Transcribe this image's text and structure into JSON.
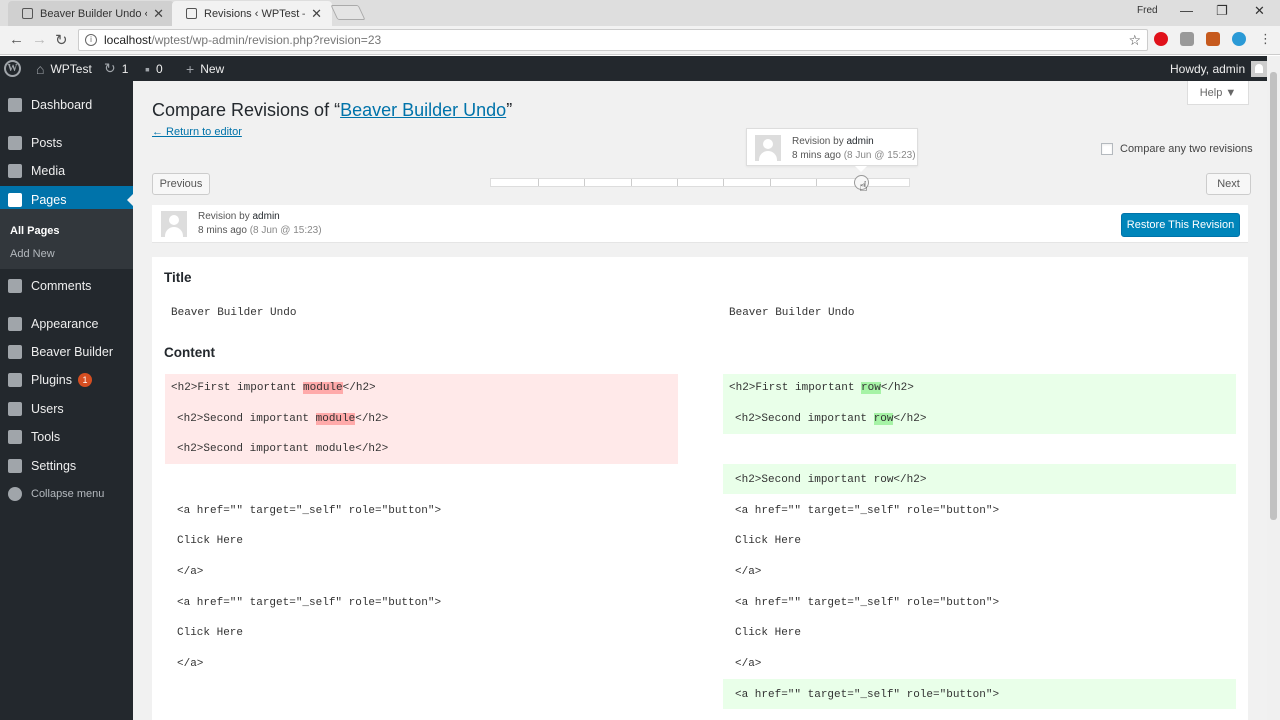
{
  "browser": {
    "tabs": [
      {
        "title": "Beaver Builder Undo ‹ W",
        "close": "✕"
      },
      {
        "title": "Revisions ‹ WPTest — Wo",
        "close": "✕"
      }
    ],
    "user": "Fred",
    "controls": {
      "minimize": "—",
      "maximize": "❐",
      "close": "✕"
    },
    "nav": {
      "back": "←",
      "forward": "→",
      "reload": "↻"
    },
    "url_host": "localhost",
    "url_path": "/wptest/wp-admin/revision.php?revision=23",
    "star": "☆"
  },
  "adminbar": {
    "site": "WPTest",
    "updates": "1",
    "comments": "0",
    "new": "New",
    "howdy": "Howdy, admin"
  },
  "sidebar": {
    "items": [
      {
        "label": "Dashboard"
      },
      {
        "label": "Posts"
      },
      {
        "label": "Media"
      },
      {
        "label": "Pages"
      },
      {
        "label": "Comments"
      },
      {
        "label": "Appearance"
      },
      {
        "label": "Beaver Builder"
      },
      {
        "label": "Plugins",
        "badge": "1"
      },
      {
        "label": "Users"
      },
      {
        "label": "Tools"
      },
      {
        "label": "Settings"
      },
      {
        "label": "Collapse menu"
      }
    ],
    "sub": [
      "All Pages",
      "Add New"
    ]
  },
  "page": {
    "help": "Help ▼",
    "title_prefix": "Compare Revisions of “",
    "title_link": "Beaver Builder Undo",
    "title_suffix": "”",
    "return_link": "← Return to editor",
    "compare_label": "Compare any two revisions",
    "prev": "Previous",
    "next": "Next",
    "tooltip": {
      "by": "Revision by",
      "author": "admin",
      "time": "8 mins ago",
      "date": "(8 Jun @ 15:23)"
    },
    "meta": {
      "by": "Revision by",
      "author": "admin",
      "time": "8 mins ago",
      "date": "(8 Jun @ 15:23)"
    },
    "restore": "Restore This Revision"
  },
  "diff": {
    "title_head": "Title",
    "title_left": "Beaver Builder Undo",
    "title_right": "Beaver Builder Undo",
    "content_head": "Content",
    "left": {
      "r1_pre": "<h2>First important ",
      "r1_hl": "module",
      "r1_post": "</h2>",
      "r2_pre": "<h2>Second important ",
      "r2_hl": "module",
      "r2_post": "</h2>",
      "r3": "<h2>Second important module</h2>"
    },
    "right": {
      "r1_pre": "<h2>First important ",
      "r1_hl": "row",
      "r1_post": "</h2>",
      "r2_pre": "<h2>Second important ",
      "r2_hl": "row",
      "r2_post": "</h2>",
      "r3": "<h2>Second important row</h2>"
    },
    "context": {
      "a_open": "<a href=\"\" target=\"_self\" role=\"button\">",
      "click": "Click Here",
      "a_close": "</a>"
    }
  }
}
